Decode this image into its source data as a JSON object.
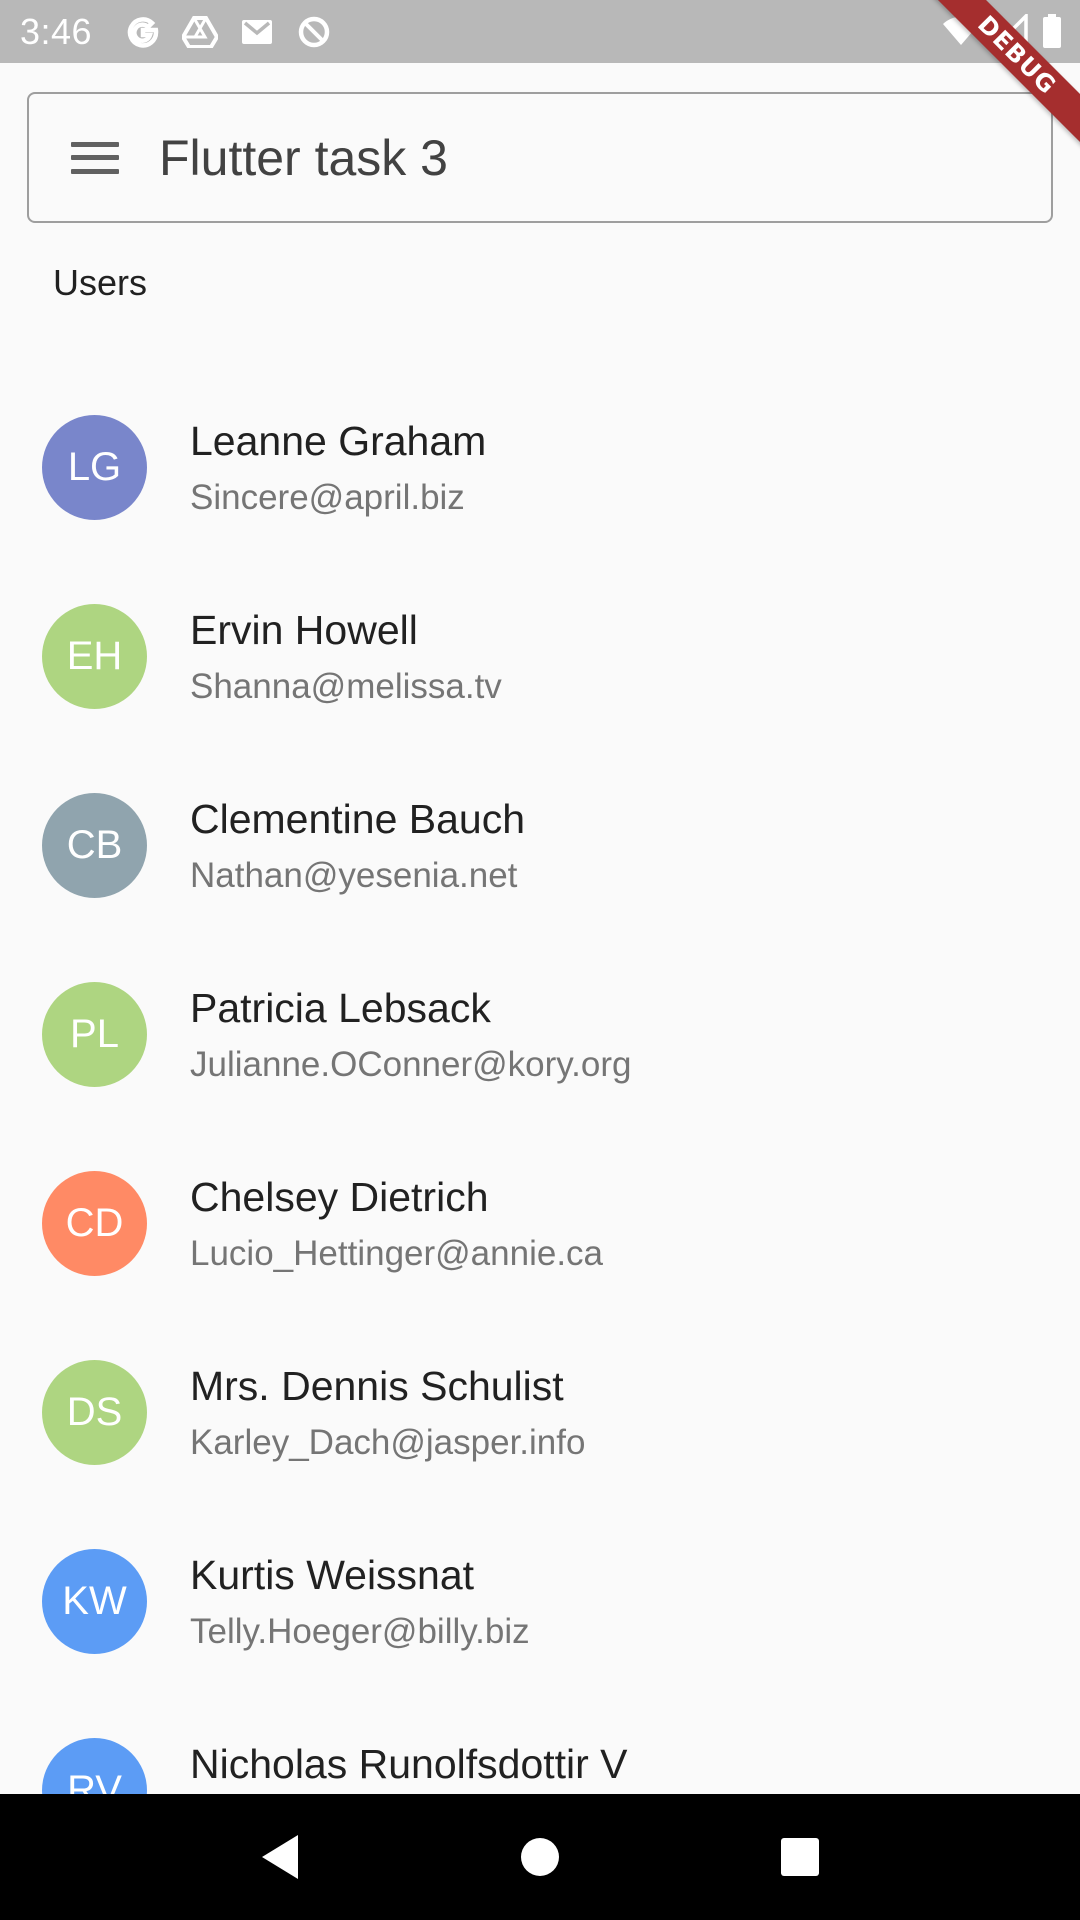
{
  "status_bar": {
    "time": "3:46",
    "left_icons": [
      "google-icon",
      "drive-icon",
      "gmail-icon",
      "data-saver-icon"
    ],
    "right_icons": [
      "wifi-icon",
      "signal-icon",
      "battery-icon"
    ]
  },
  "debug_banner": "DEBUG",
  "app_bar": {
    "title": "Flutter task 3",
    "menu_icon": "menu-icon"
  },
  "section_label": "Users",
  "users": [
    {
      "initials": "LG",
      "name": "Leanne Graham",
      "email": "Sincere@april.biz",
      "color": "#7986cb"
    },
    {
      "initials": "EH",
      "name": "Ervin Howell",
      "email": "Shanna@melissa.tv",
      "color": "#aed581"
    },
    {
      "initials": "CB",
      "name": "Clementine Bauch",
      "email": "Nathan@yesenia.net",
      "color": "#90a4ae"
    },
    {
      "initials": "PL",
      "name": "Patricia Lebsack",
      "email": "Julianne.OConner@kory.org",
      "color": "#aed581"
    },
    {
      "initials": "CD",
      "name": "Chelsey Dietrich",
      "email": "Lucio_Hettinger@annie.ca",
      "color": "#ff8a65"
    },
    {
      "initials": "DS",
      "name": "Mrs. Dennis Schulist",
      "email": "Karley_Dach@jasper.info",
      "color": "#aed581"
    },
    {
      "initials": "KW",
      "name": "Kurtis Weissnat",
      "email": "Telly.Hoeger@billy.biz",
      "color": "#5c9cf5"
    },
    {
      "initials": "RV",
      "name": "Nicholas Runolfsdottir V",
      "email": "",
      "color": "#5c9cf5"
    }
  ],
  "nav_bar": {
    "buttons": [
      "back-icon",
      "home-icon",
      "recents-icon"
    ]
  }
}
